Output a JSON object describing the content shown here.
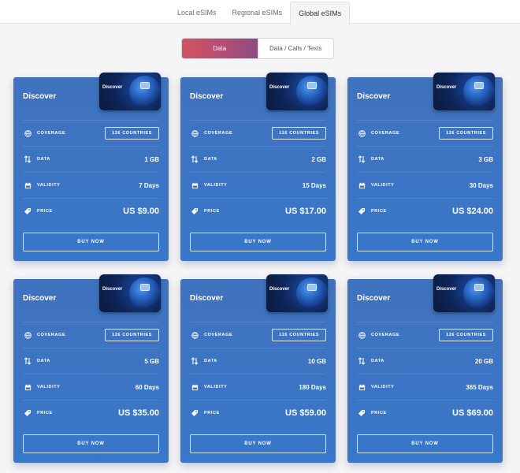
{
  "tabs": [
    {
      "label": "Local eSIMs",
      "active": false
    },
    {
      "label": "Regional eSIMs",
      "active": false
    },
    {
      "label": "Global eSIMs",
      "active": true
    }
  ],
  "segments": [
    {
      "label": "Data",
      "active": true
    },
    {
      "label": "Data / Calls / Texts",
      "active": false
    }
  ],
  "labels": {
    "coverage": "COVERAGE",
    "data": "DATA",
    "validity": "VALIDITY",
    "price": "PRICE",
    "buy": "BUY NOW"
  },
  "icons": {
    "coverage": "globe-icon",
    "data": "arrows-up-down-icon",
    "validity": "calendar-icon",
    "price": "price-tag-icon"
  },
  "colors": {
    "card": "#3b74c4",
    "segment_active_start": "#d25362",
    "segment_active_end": "#8c4c82"
  },
  "plans": [
    {
      "name": "Discover",
      "sim_label": "Discover",
      "coverage": "126 COUNTRIES",
      "data": "1 GB",
      "validity": "7 Days",
      "price": "US $9.00"
    },
    {
      "name": "Discover",
      "sim_label": "Discover",
      "coverage": "126 COUNTRIES",
      "data": "2 GB",
      "validity": "15 Days",
      "price": "US $17.00"
    },
    {
      "name": "Discover",
      "sim_label": "Discover",
      "coverage": "126 COUNTRIES",
      "data": "3 GB",
      "validity": "30 Days",
      "price": "US $24.00"
    },
    {
      "name": "Discover",
      "sim_label": "Discover",
      "coverage": "126 COUNTRIES",
      "data": "5 GB",
      "validity": "60 Days",
      "price": "US $35.00"
    },
    {
      "name": "Discover",
      "sim_label": "Discover",
      "coverage": "126 COUNTRIES",
      "data": "10 GB",
      "validity": "180 Days",
      "price": "US $59.00"
    },
    {
      "name": "Discover",
      "sim_label": "Discover",
      "coverage": "126 COUNTRIES",
      "data": "20 GB",
      "validity": "365 Days",
      "price": "US $69.00"
    }
  ]
}
